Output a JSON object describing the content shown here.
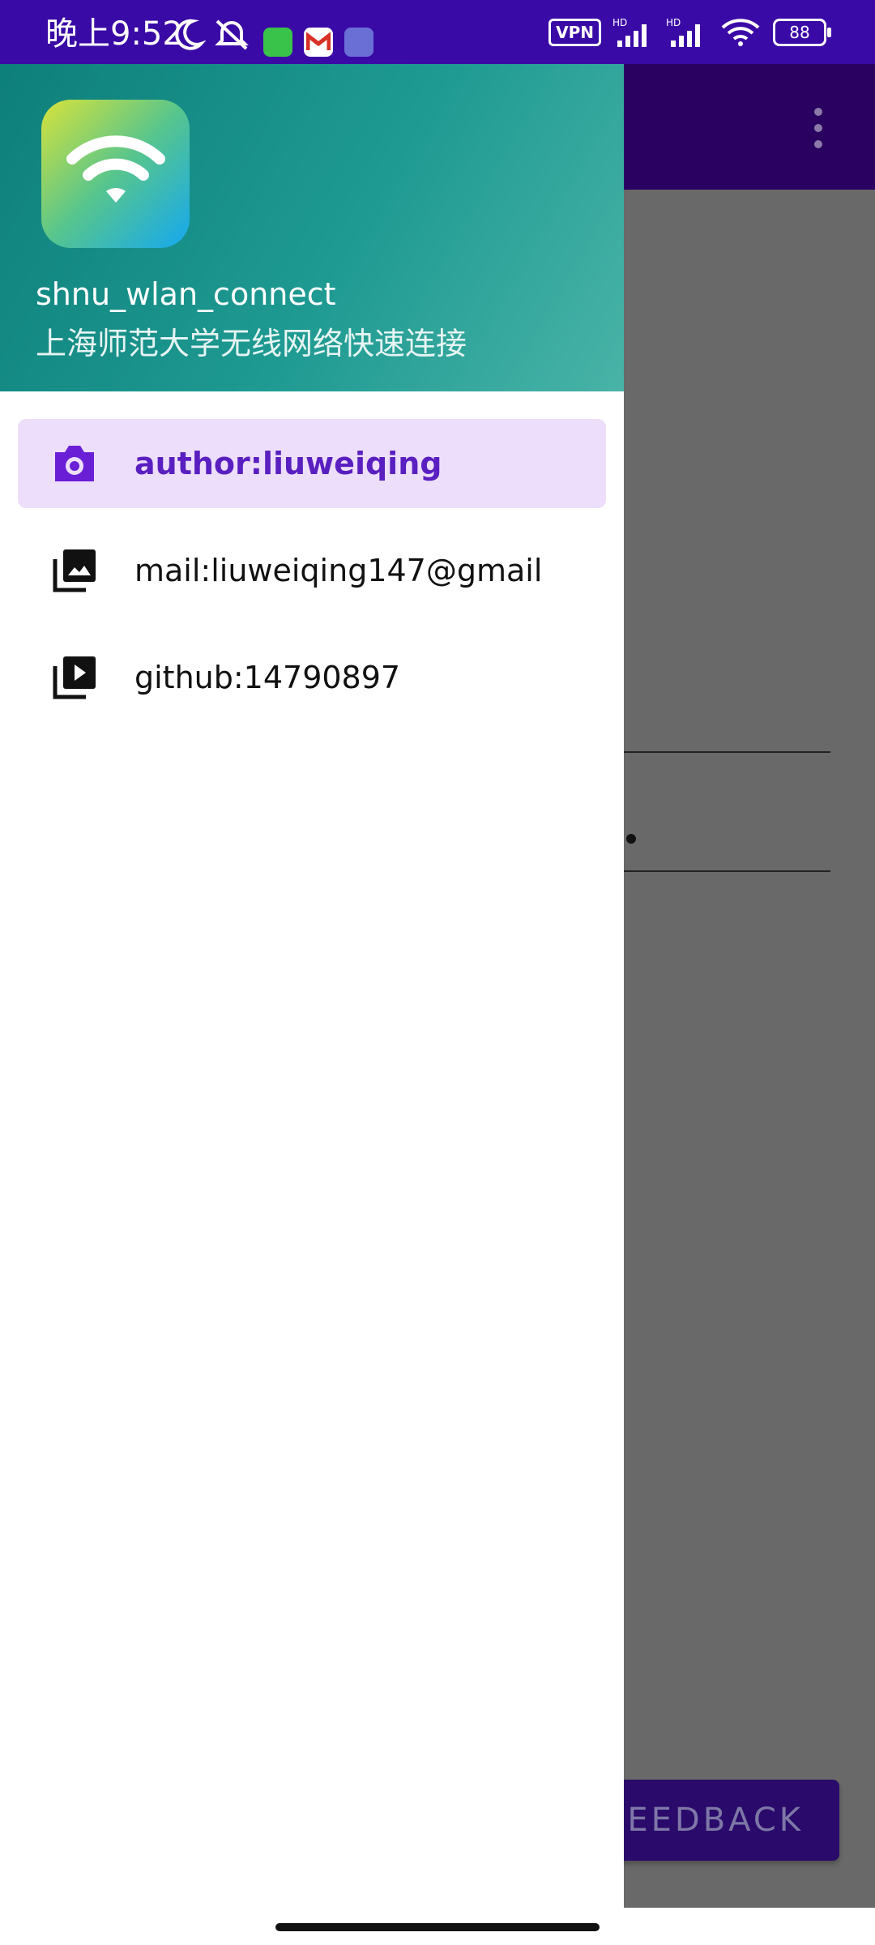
{
  "status_bar": {
    "time": "晚上9:52",
    "vpn_label": "VPN",
    "battery": "88",
    "icons": [
      "moon-icon",
      "bell-off-icon",
      "app-icon-green",
      "gmail-icon",
      "app-icon-purple",
      "hd-signal-icon",
      "hd-signal-icon",
      "wifi-icon",
      "battery-icon"
    ]
  },
  "drawer": {
    "header": {
      "title": "shnu_wlan_connect",
      "subtitle": "上海师范大学无线网络快速连接"
    },
    "items": [
      {
        "label": "author:liuweiqing",
        "icon": "camera-icon",
        "selected": true
      },
      {
        "label": "mail:liuweiqing147@gmail",
        "icon": "image-icon",
        "selected": false
      },
      {
        "label": "github:14790897",
        "icon": "video-library-icon",
        "selected": false
      }
    ]
  },
  "background": {
    "feedback_label": "FEEDBACK"
  },
  "colors": {
    "status_bar": "#3a0aa6",
    "accent": "#5a1fc0",
    "selected_bg": "#eddffb",
    "header_gradient_start": "#0e7f7b",
    "header_gradient_end": "#49b3a7"
  }
}
